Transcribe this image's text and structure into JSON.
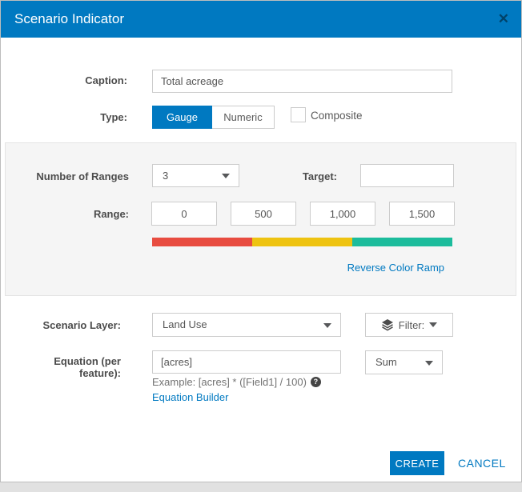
{
  "header": {
    "title": "Scenario Indicator",
    "close_icon": "✕"
  },
  "form": {
    "caption": {
      "label": "Caption:",
      "value": "Total acreage"
    },
    "type": {
      "label": "Type:",
      "options": [
        {
          "label": "Gauge",
          "selected": true
        },
        {
          "label": "Numeric",
          "selected": false
        }
      ],
      "composite": {
        "label": "Composite",
        "checked": false
      }
    }
  },
  "ranges_panel": {
    "number_of_ranges": {
      "label": "Number of Ranges",
      "value": "3"
    },
    "target": {
      "label": "Target:",
      "value": ""
    },
    "range": {
      "label": "Range:",
      "values": [
        "0",
        "500",
        "1,000",
        "1,500"
      ]
    },
    "color_ramp": {
      "colors": [
        "#e84c40",
        "#eec311",
        "#1cbc9c"
      ]
    },
    "reverse_link": "Reverse Color Ramp"
  },
  "layer_section": {
    "scenario_layer": {
      "label": "Scenario Layer:",
      "value": "Land Use"
    },
    "filter": {
      "label": "Filter:"
    },
    "equation": {
      "label_line1": "Equation (per",
      "label_line2": "feature):",
      "value": "[acres]",
      "example": "Example: [acres] * ([Field1] / 100)",
      "help_icon": "?",
      "builder_link": "Equation Builder"
    },
    "aggregation": {
      "value": "Sum"
    }
  },
  "footer": {
    "create": "CREATE",
    "cancel": "CANCEL"
  },
  "colors": {
    "accent": "#0079c1",
    "header_bg": "#0079c1",
    "panel_bg": "#f5f5f5"
  }
}
